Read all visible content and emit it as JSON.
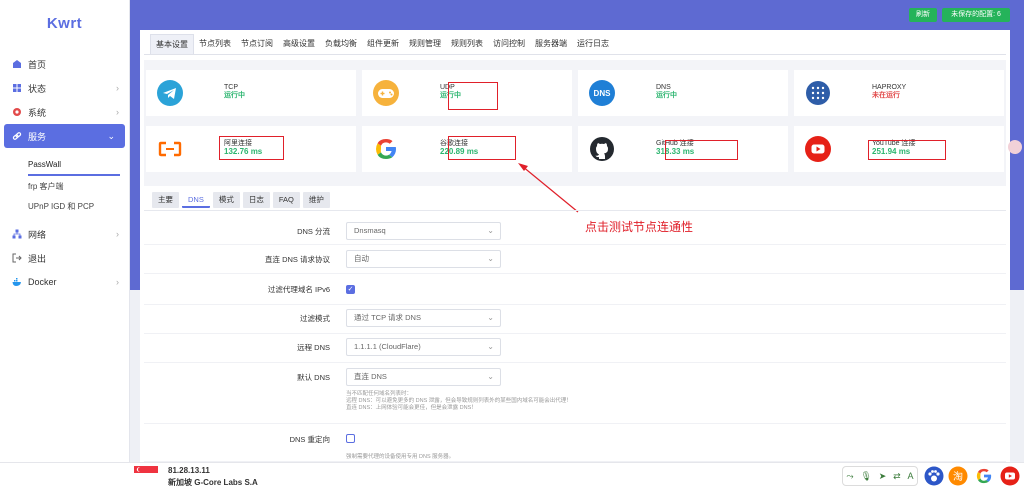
{
  "sidebar": {
    "logo": "Kwrt",
    "items": [
      {
        "label": "首页"
      },
      {
        "label": "状态"
      },
      {
        "label": "系统"
      },
      {
        "label": "服务"
      },
      {
        "label": "网络"
      },
      {
        "label": "退出"
      },
      {
        "label": "Docker"
      }
    ],
    "sub_items": [
      {
        "label": "PassWall"
      },
      {
        "label": "frp 客户端"
      },
      {
        "label": "UPnP IGD 和 PCP"
      }
    ]
  },
  "header": {
    "refresh_label": "刷新",
    "unsaved_label": "未保存的配置: 6"
  },
  "tabs": [
    "基本设置",
    "节点列表",
    "节点订阅",
    "高级设置",
    "负载均衡",
    "组件更新",
    "规则管理",
    "规则列表",
    "访问控制",
    "服务器端",
    "运行日志"
  ],
  "status_cards": [
    {
      "name": "TCP",
      "status": "运行中"
    },
    {
      "name": "UDP",
      "status": "运行中"
    },
    {
      "name": "DNS",
      "status": "运行中"
    },
    {
      "name": "HAPROXY",
      "status": "未在运行"
    },
    {
      "name": "阿里连接",
      "status": "132.76 ms"
    },
    {
      "name": "谷歌连接",
      "status": "220.89 ms"
    },
    {
      "name": "GitHub 连接",
      "status": "318.33 ms"
    },
    {
      "name": "YouTube 连接",
      "status": "251.94 ms"
    }
  ],
  "subtabs": [
    "主要",
    "DNS",
    "模式",
    "日志",
    "FAQ",
    "维护"
  ],
  "form": {
    "dns_shunt": {
      "label": "DNS 分流",
      "value": "Dnsmasq"
    },
    "direct_protocol": {
      "label": "直连 DNS 请求协议",
      "value": "自动"
    },
    "filter_ipv6": {
      "label": "过滤代理域名 IPv6"
    },
    "filter_mode": {
      "label": "过滤模式",
      "value": "通过 TCP 请求 DNS"
    },
    "remote_dns": {
      "label": "远程 DNS",
      "value": "1.1.1.1 (CloudFlare)"
    },
    "default_dns": {
      "label": "默认 DNS",
      "value": "直连 DNS"
    },
    "default_dns_hint": [
      "当不匹配任何域名列表时：",
      "远程 DNS：可以避免更多的 DNS 泄露，但会导致规则列表外的某些国内域名可能会出代理！",
      "直连 DNS：上网体验可能会更佳，但是会泄露 DNS！"
    ],
    "dns_redirect": {
      "label": "DNS 重定向"
    },
    "dns_redirect_hint": "强制需要代理的设备使用专用 DNS 服务器。"
  },
  "annotation": "点击测试节点连通性",
  "bottom": {
    "ip": "81.28.13.11",
    "isp": "新加坡 G-Core Labs S.A"
  },
  "colors": {
    "accent": "#5b6ee1",
    "band": "#5e6ad2",
    "success": "#25b35a",
    "status_ok": "#2bb56f",
    "status_bad": "#e24a4a",
    "annotation": "#e0202a"
  }
}
